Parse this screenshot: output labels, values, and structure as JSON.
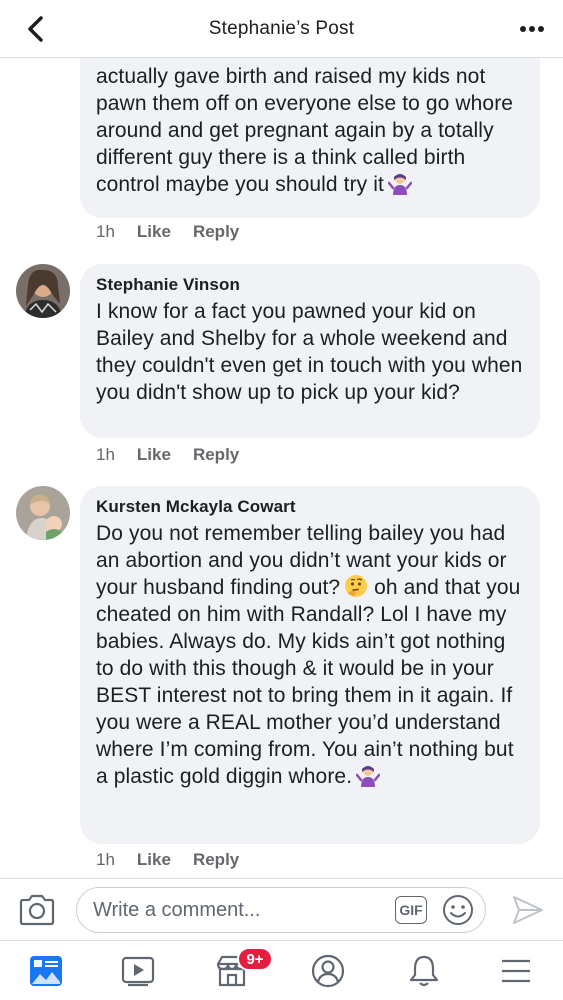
{
  "header": {
    "title": "Stephanie’s Post"
  },
  "comments": [
    {
      "author": "",
      "text": "actually gave birth and raised my kids not pawn them off on everyone else to go whore around and get pregnant again by a totally different guy there is a think called birth control maybe you should try it",
      "emoji_end": "person-shrugging-emoji",
      "time": "1h",
      "like": "Like",
      "reply": "Reply"
    },
    {
      "author": "Stephanie Vinson",
      "text": "I know for a fact you pawned your kid on Bailey and Shelby for a whole weekend and they couldn't even get in touch with you when you didn't show up to pick up your kid?",
      "time": "1h",
      "like": "Like",
      "reply": "Reply"
    },
    {
      "author": "Kursten Mckayla Cowart",
      "text_part1": "Do you not remember telling bailey you had an abortion and you didn’t want your kids or your husband finding out?",
      "emoji_mid": "thinking-face-emoji",
      "text_part2": " oh and that you cheated on him with Randall? Lol I have my babies. Always do. My kids ain’t got nothing to do with this though & it would be in your BEST interest not to bring them in it again. If you were a REAL mother you’d understand where I’m coming from. You ain’t nothing but a plastic gold diggin whore.",
      "emoji_end": "person-shrugging-emoji",
      "time": "1h",
      "like": "Like",
      "reply": "Reply"
    }
  ],
  "composer": {
    "placeholder": "Write a comment...",
    "gif_label": "GIF"
  },
  "tabbar": {
    "marketplace_badge": "9+"
  },
  "colors": {
    "accent": "#1877f2",
    "badge": "#e41e3f",
    "bubble": "#f0f2f5",
    "meta": "#65676b"
  }
}
